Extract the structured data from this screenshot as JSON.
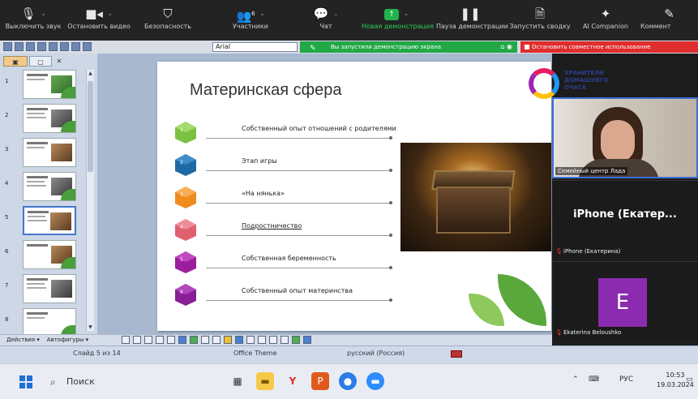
{
  "zoom_toolbar": {
    "items": [
      {
        "label": "Выключить звук",
        "icon": "microphone-icon"
      },
      {
        "label": "Остановить видео",
        "icon": "video-camera-icon"
      },
      {
        "label": "Безопасность",
        "icon": "shield-icon"
      },
      {
        "label": "Участники",
        "icon": "participants-icon",
        "count": "6"
      },
      {
        "label": "Чат",
        "icon": "chat-icon"
      },
      {
        "label": "Новая демонстрация",
        "icon": "share-screen-icon"
      },
      {
        "label": "Пауза демонстрации",
        "icon": "pause-icon"
      },
      {
        "label": "Запустить сводку",
        "icon": "summary-icon"
      },
      {
        "label": "AI Companion",
        "icon": "ai-sparkle-icon"
      },
      {
        "label": "Коммент",
        "icon": "comment-icon"
      }
    ],
    "accent": "#23b14d"
  },
  "ppt_ribbon": {
    "font_name": "Arial"
  },
  "share_banner": {
    "text": "Вы запустили демонстрацию экрана",
    "color": "#22a845"
  },
  "stop_share": {
    "label": "Остановить совместное использование",
    "color": "#e02d2d"
  },
  "slides_pane": {
    "numbers": [
      "1",
      "2",
      "3",
      "4",
      "5",
      "6",
      "7",
      "8"
    ],
    "selected": "5"
  },
  "slide": {
    "title": "Материнская сфера",
    "logo_text": [
      "ХРАНИТЕЛИ",
      "ДОМАШНЕГО",
      "ОЧАГА"
    ],
    "items": [
      {
        "num": "1",
        "text": "Собственный опыт отношений с родителями",
        "color": "#7cc242"
      },
      {
        "num": "2",
        "text": "Этап игры",
        "color": "#1e6aa6"
      },
      {
        "num": "3",
        "text": "«На нянька»",
        "color": "#f08c1e"
      },
      {
        "num": "4",
        "text": "Подростничество",
        "color": "#e0606e"
      },
      {
        "num": "5",
        "text": "Собственная беременность",
        "color": "#9b1e9e"
      },
      {
        "num": "6",
        "text": "Собственный опыт материнства",
        "color": "#8a1e96"
      }
    ]
  },
  "participants": {
    "video_name": "Семейный центр Лада",
    "tile2_big": "iPhone (Екатер...",
    "tile2_name": "iPhone (Екатерина)",
    "tile3_initial": "E",
    "tile3_name": "Ekaterina Beloushko",
    "avatar_color": "#8b2bb0"
  },
  "draw_toolbar": {
    "actions": "Действия ▾",
    "autoshapes": "Автофигуры ▾"
  },
  "status_bar": {
    "slide": "Слайд 5 из 14",
    "theme": "Office Theme",
    "language": "русский (Россия)"
  },
  "taskbar": {
    "search_placeholder": "Поиск",
    "lang": "РУС",
    "time": "10:53",
    "date": "19.03.2024"
  }
}
